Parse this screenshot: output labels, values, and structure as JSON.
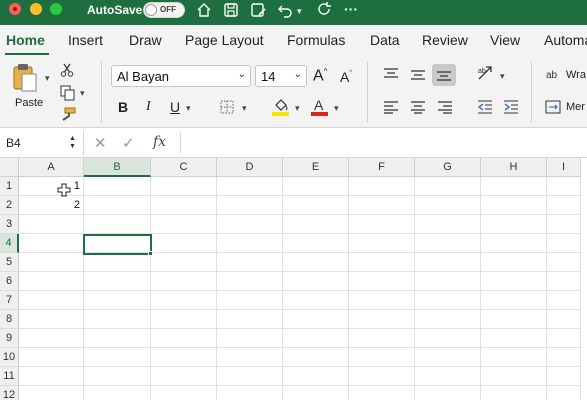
{
  "titlebar": {
    "autosave_label": "AutoSave",
    "toggle_text": "OFF",
    "icons": [
      "home-icon",
      "save-icon",
      "save-as-icon",
      "undo-icon",
      "redo-icon",
      "more-icon"
    ],
    "more": "···",
    "color": "#1e6f3f"
  },
  "tabs": [
    {
      "label": "Home",
      "active": true
    },
    {
      "label": "Insert"
    },
    {
      "label": "Draw"
    },
    {
      "label": "Page Layout"
    },
    {
      "label": "Formulas"
    },
    {
      "label": "Data"
    },
    {
      "label": "Review"
    },
    {
      "label": "View"
    },
    {
      "label": "Automa"
    }
  ],
  "ribbon": {
    "paste_label": "Paste",
    "font_name": "Al Bayan",
    "font_size": "14",
    "bold": "B",
    "italic": "I",
    "underline": "U",
    "wrap_label": "Wra",
    "merge_label": "Mer",
    "fill_color": "#f7e600",
    "font_color": "#e0201b"
  },
  "formula_bar": {
    "name_box": "B4",
    "cancel": "✕",
    "enter": "✓",
    "fx": "fx",
    "content": ""
  },
  "sheet": {
    "columns": [
      "A",
      "B",
      "C",
      "D",
      "E",
      "F",
      "G",
      "H",
      "I"
    ],
    "rows": [
      "1",
      "2",
      "3",
      "4",
      "5",
      "6",
      "7",
      "8",
      "9",
      "10",
      "11",
      "12"
    ],
    "selected_cell": "B4",
    "cells": {
      "A1": "1",
      "A2": "2"
    }
  }
}
